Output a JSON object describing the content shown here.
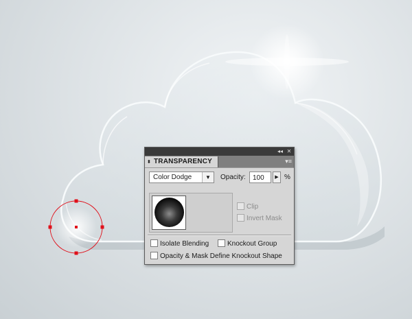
{
  "canvas": {
    "background": "#dfe4e7",
    "selection_color": "#e0101a",
    "artwork": "glass-cloud"
  },
  "panel": {
    "titlebar": {
      "collapse_icon": "double-chevron-icon",
      "close_icon": "close-icon",
      "collapse_glyph": "◂◂",
      "close_glyph": "✕"
    },
    "tab": {
      "label": "TRANSPARENCY",
      "arrows_glyph": "⬍"
    },
    "menu_glyph": "▾≡",
    "blend_mode": {
      "selected": "Color Dodge",
      "caret_glyph": "▼"
    },
    "opacity": {
      "label": "Opacity:",
      "value": "100",
      "step_glyph": "▶",
      "unit": "%"
    },
    "mask_options": {
      "clip": {
        "label": "Clip",
        "checked": false,
        "enabled": false
      },
      "invert_mask": {
        "label": "Invert Mask",
        "checked": false,
        "enabled": false
      }
    },
    "options": {
      "isolate_blending": {
        "label": "Isolate Blending",
        "checked": false
      },
      "knockout_group": {
        "label": "Knockout Group",
        "checked": false
      },
      "define_knockout": {
        "label": "Opacity & Mask Define Knockout Shape",
        "checked": false
      }
    }
  }
}
